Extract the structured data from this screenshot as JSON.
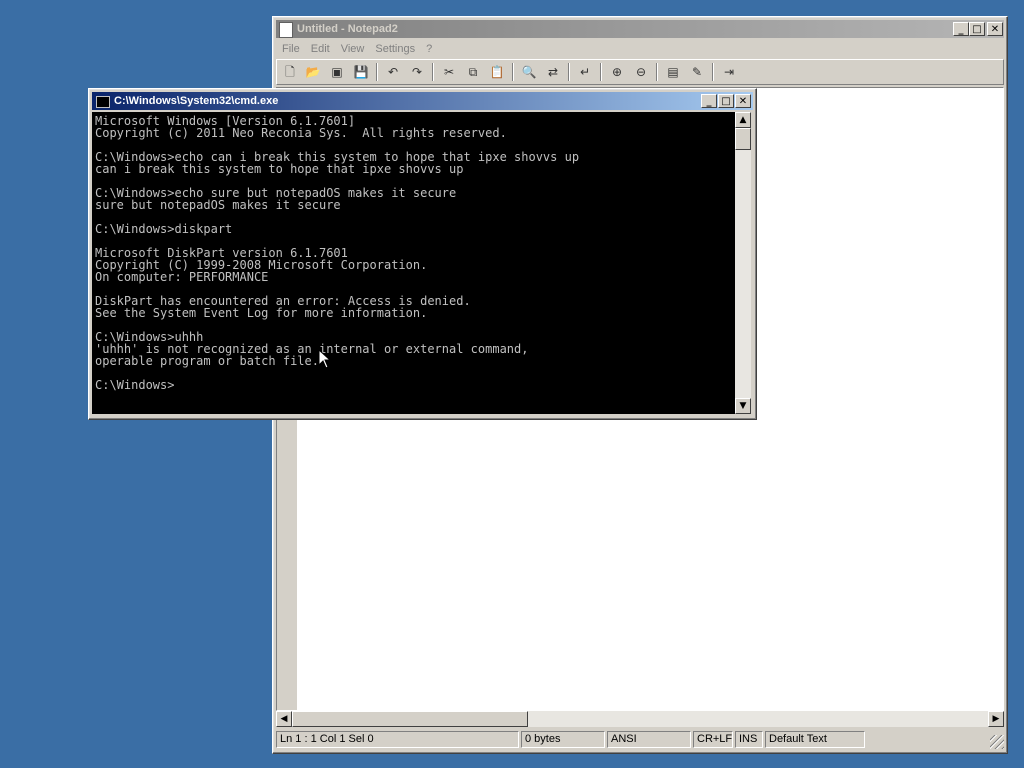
{
  "notepad": {
    "title": "Untitled - Notepad2",
    "menu": [
      "File",
      "Edit",
      "View",
      "Settings",
      "?"
    ],
    "toolbar_icons": [
      "new-icon",
      "open-icon",
      "browse-icon",
      "save-icon",
      "undo-icon",
      "redo-icon",
      "cut-icon",
      "copy-icon",
      "paste-icon",
      "find-icon",
      "replace-icon",
      "wordwrap-icon",
      "zoom-in-icon",
      "zoom-out-icon",
      "select-scheme-icon",
      "customize-scheme-icon",
      "exit-icon"
    ],
    "status": {
      "position": "Ln 1 : 1   Col 1   Sel 0",
      "size": "0 bytes",
      "encoding": "ANSI",
      "line_endings": "CR+LF",
      "insert_mode": "INS",
      "scheme": "Default Text"
    }
  },
  "cmd": {
    "title": "C:\\Windows\\System32\\cmd.exe",
    "output": "Microsoft Windows [Version 6.1.7601]\nCopyright (c) 2011 Neo Reconia Sys.  All rights reserved.\n\nC:\\Windows>echo can i break this system to hope that ipxe shovvs up\ncan i break this system to hope that ipxe shovvs up\n\nC:\\Windows>echo sure but notepadOS makes it secure\nsure but notepadOS makes it secure\n\nC:\\Windows>diskpart\n\nMicrosoft DiskPart version 6.1.7601\nCopyright (C) 1999-2008 Microsoft Corporation.\nOn computer: PERFORMANCE\n\nDiskPart has encountered an error: Access is denied.\nSee the System Event Log for more information.\n\nC:\\Windows>uhhh\n'uhhh' is not recognized as an internal or external command,\noperable program or batch file.\n\nC:\\Windows>"
  },
  "colors": {
    "desktop": "#3a6ea5",
    "active_title": "#0a246a",
    "inactive_title": "#808080",
    "console_bg": "#000000",
    "console_fg": "#c0c0c0"
  }
}
